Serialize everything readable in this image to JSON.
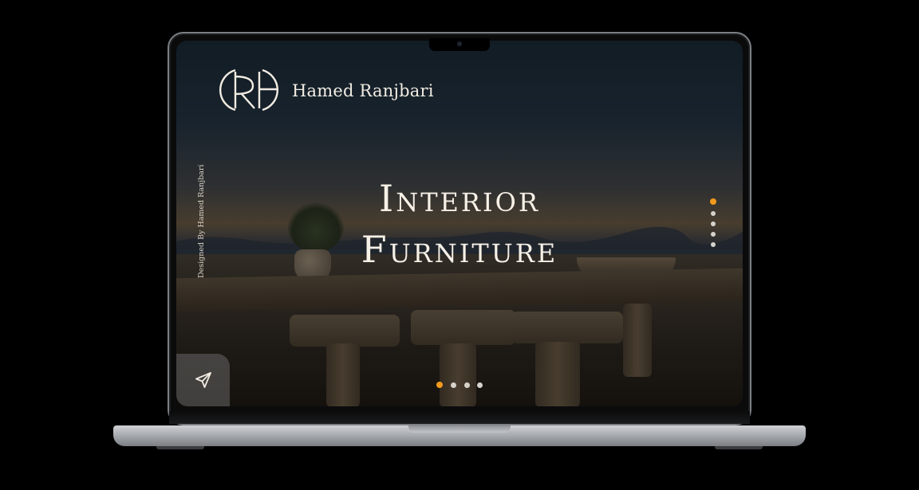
{
  "brand": {
    "name": "Hamed Ranjbari",
    "logo_icon": "rh-monogram-icon"
  },
  "sidebar": {
    "credit": "Designed By Hamed Ranjbari"
  },
  "hero": {
    "title_line_1": "Interior",
    "title_line_2": "Furniture"
  },
  "slider": {
    "side_dots": 5,
    "side_active_index": 0,
    "bottom_dots": 4,
    "bottom_active_index": 0
  },
  "actions": {
    "send_icon": "paper-plane-icon"
  },
  "colors": {
    "accent": "#f39a1c",
    "text": "#f6f0e6",
    "dot_inactive": "#d6d2cc"
  }
}
